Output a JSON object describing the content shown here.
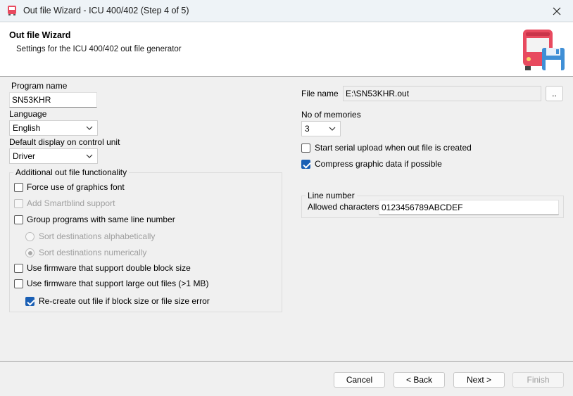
{
  "window": {
    "title": "Out file Wizard - ICU 400/402 (Step 4 of 5)"
  },
  "header": {
    "title": "Out file Wizard",
    "subtitle": "Settings for the ICU 400/402 out file generator"
  },
  "left": {
    "program_name_label": "Program name",
    "program_name_value": "SN53KHR",
    "language_label": "Language",
    "language_value": "English",
    "default_display_label": "Default display on control unit",
    "default_display_value": "Driver",
    "group_title": "Additional out file functionality",
    "options": {
      "force_graphics_font": "Force use of graphics font",
      "add_smartblind": "Add Smartblind support",
      "group_programs": "Group programs with same line number",
      "sort_alpha": "Sort destinations alphabetically",
      "sort_numeric": "Sort destinations numerically",
      "double_block": "Use firmware that support double block size",
      "large_files": "Use firmware that support large out files (>1 MB)",
      "recreate": "Re-create out file if block size or file size error"
    }
  },
  "right": {
    "file_name_label": "File name",
    "file_name_value": "E:\\SN53KHR.out",
    "browse_label": "..",
    "memories_label": "No of memories",
    "memories_value": "3",
    "serial_upload": "Start serial upload when out file is created",
    "compress": "Compress graphic data if possible",
    "line_group_title": "Line number",
    "allowed_label": "Allowed characters",
    "allowed_value": "0123456789ABCDEF"
  },
  "footer": {
    "cancel": "Cancel",
    "back": "< Back",
    "next": "Next >",
    "finish": "Finish"
  },
  "colors": {
    "accent": "#1a5fb4",
    "header_bg": "#ffffff",
    "body_bg": "#f0f0f0"
  }
}
